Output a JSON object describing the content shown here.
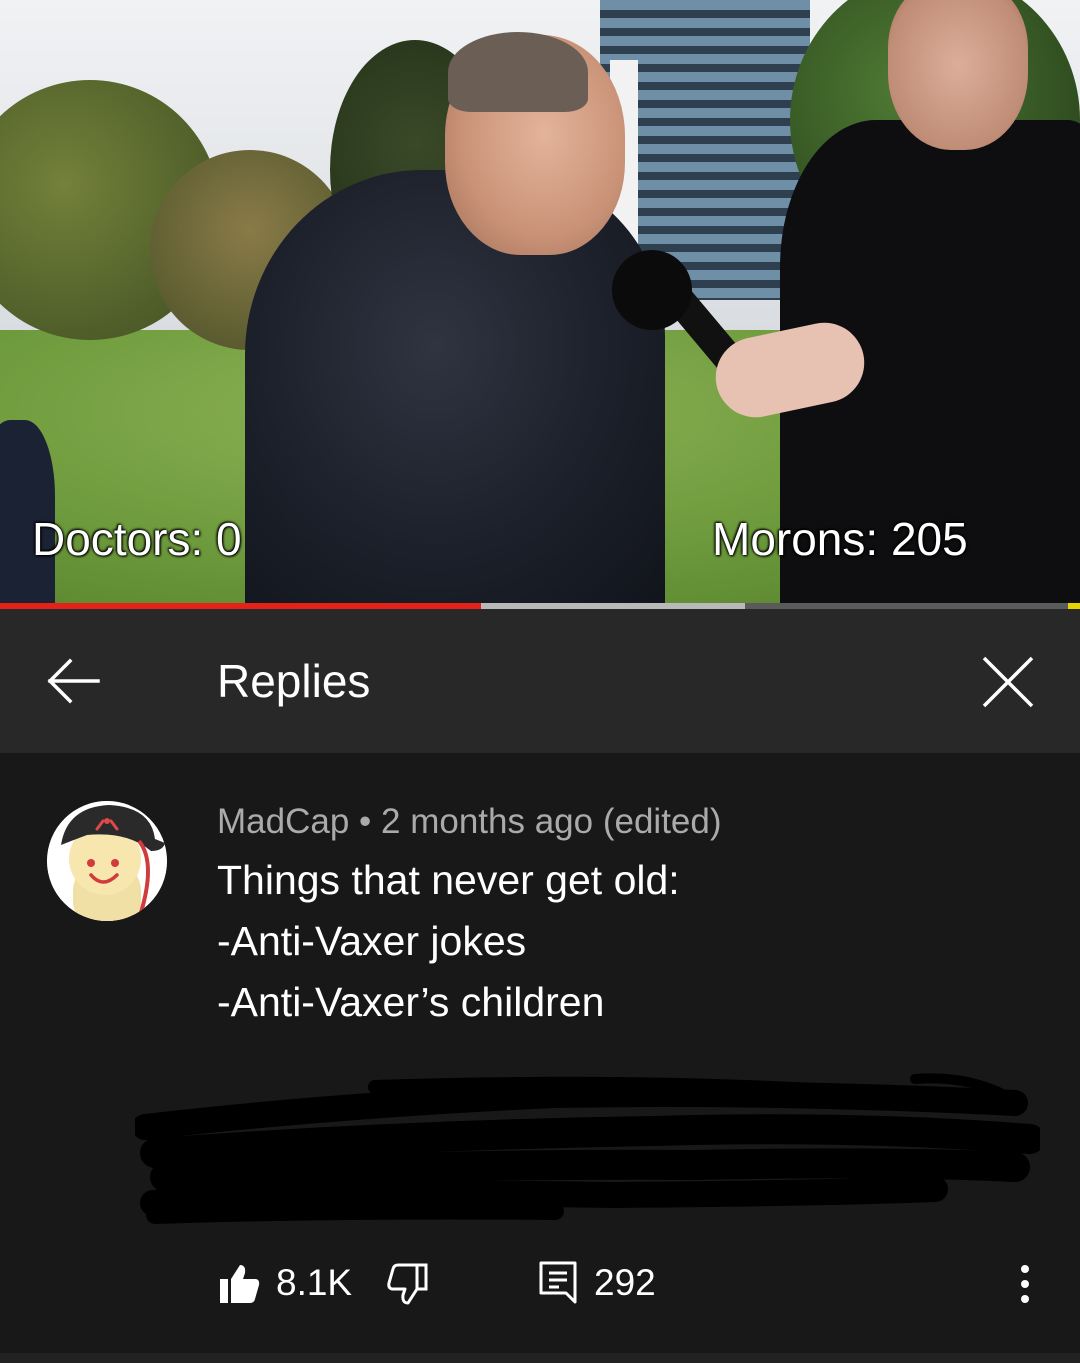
{
  "video": {
    "overlay_left": "Doctors: 0",
    "overlay_right": "Morons: 205",
    "progress": {
      "played_fraction": 0.445,
      "buffered_fraction": 0.69
    },
    "colors": {
      "played": "#e62117",
      "buffer": "#b9b9b9",
      "track": "#5a5a5a"
    }
  },
  "header": {
    "title": "Replies",
    "back_icon": "arrow-left-icon",
    "close_icon": "close-icon"
  },
  "comment": {
    "author": "MadCap",
    "separator": "•",
    "time": "2 months ago (edited)",
    "lines": [
      "Things that never get old:",
      "-Anti-Vaxer jokes",
      "-Anti-Vaxer’s children"
    ],
    "avatar_icon": "cartoon-avatar",
    "likes": "8.1K",
    "replies": "292",
    "like_icon": "thumbs-up-icon",
    "dislike_icon": "thumbs-down-icon",
    "reply_icon": "comment-icon",
    "more_icon": "more-vertical-icon"
  },
  "colors": {
    "background": "#181818",
    "header_bg": "#282828",
    "meta_text": "#aaaaaa"
  }
}
